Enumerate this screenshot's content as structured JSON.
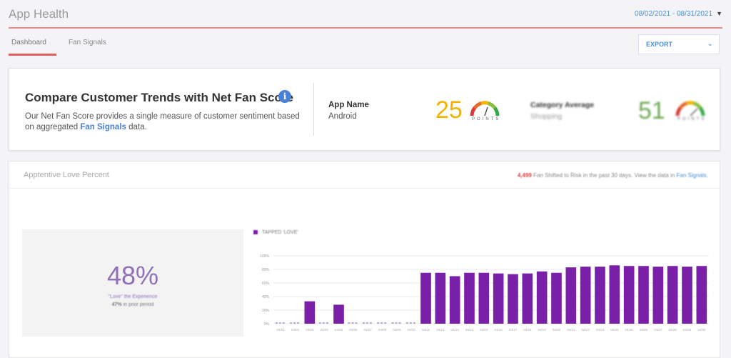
{
  "header": {
    "title": "App Health",
    "date_range": "08/02/2021 - 08/31/2021"
  },
  "tabs": [
    {
      "label": "Dashboard",
      "active": true
    },
    {
      "label": "Fan Signals",
      "active": false
    }
  ],
  "export": {
    "label": "EXPORT"
  },
  "trend_card": {
    "title": "Compare Customer Trends with Net Fan Score",
    "info_icon": "info-icon",
    "desc_prefix": "Our Net Fan Score provides a single measure of customer sentiment based on aggregated ",
    "desc_link": "Fan Signals",
    "desc_suffix": " data.",
    "app": {
      "label": "App Name",
      "platform": "Android",
      "score": "25",
      "score_color": "#f0b400",
      "gauge_text": "POINTS"
    },
    "category": {
      "label": "Category Average",
      "sub": "Shopping",
      "score": "51",
      "score_color": "#6aa84f",
      "gauge_text": "POINTS"
    }
  },
  "love_card": {
    "title": "Apptentive Love Percent",
    "note_count": "4,499",
    "note_text": " Fan Shifted to Risk in the past 30 days. View the data in ",
    "note_link": "Fan Signals.",
    "percent": "48%",
    "sub_line1": "\"Love\" the Experience",
    "sub_line2_bold": "47%",
    "sub_line2": " in prior period"
  },
  "chart_data": {
    "type": "bar",
    "legend": "TAPPED 'LOVE'",
    "color": "#7a1fa8",
    "ylim": [
      0,
      100
    ],
    "yticks": [
      "0%",
      "20%",
      "40%",
      "60%",
      "80%",
      "100%"
    ],
    "categories": [
      "04/01",
      "04/02",
      "04/03",
      "04/04",
      "04/05",
      "04/06",
      "04/07",
      "04/08",
      "04/09",
      "04/10",
      "04/11",
      "04/12",
      "04/13",
      "04/14",
      "04/15",
      "04/16",
      "04/17",
      "04/18",
      "04/19",
      "04/20",
      "04/21",
      "04/22",
      "04/23",
      "04/24",
      "04/25",
      "04/26",
      "04/27",
      "04/28",
      "04/29",
      "04/30"
    ],
    "values": [
      0,
      0,
      33,
      0,
      28,
      0,
      0,
      0,
      0,
      0,
      75,
      75,
      70,
      75,
      75,
      74,
      73,
      74,
      77,
      75,
      83,
      84,
      84,
      86,
      85,
      85,
      84,
      85,
      84,
      85
    ]
  }
}
